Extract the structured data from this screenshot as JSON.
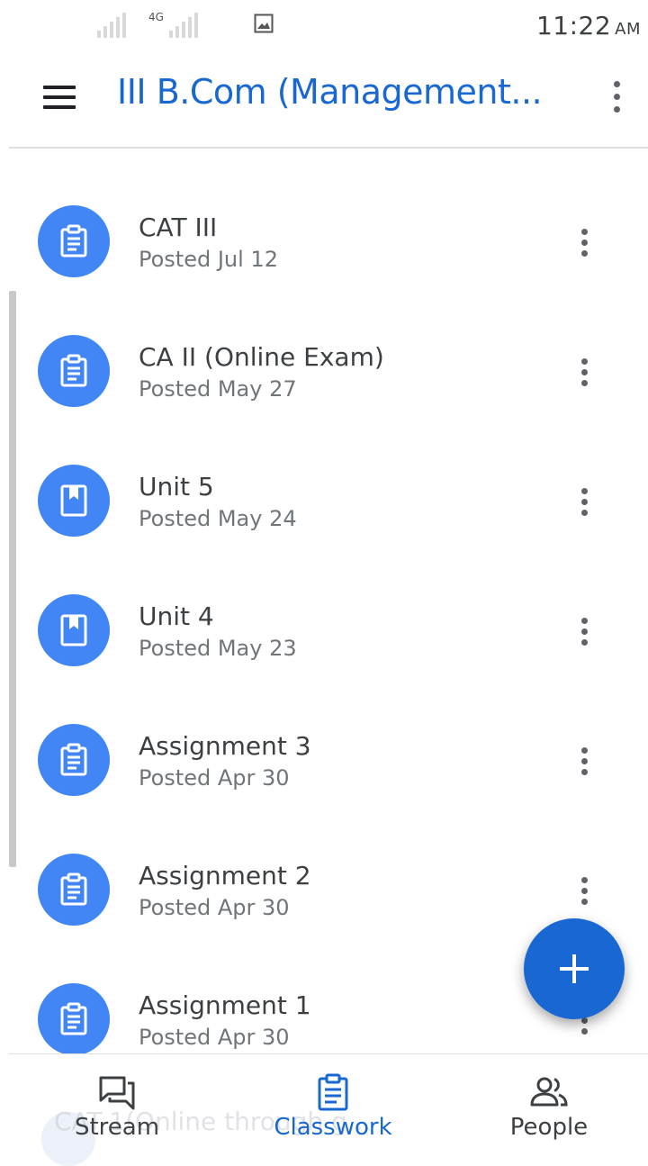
{
  "status_bar": {
    "network": "4G",
    "time": "11:22",
    "ampm": "AM"
  },
  "app_bar": {
    "title": "III B.Com (Management..."
  },
  "items": [
    {
      "title": "CAT III",
      "posted": "Posted Jul 12",
      "icon": "assignment-icon"
    },
    {
      "title": "CA II (Online Exam)",
      "posted": "Posted May 27",
      "icon": "assignment-icon"
    },
    {
      "title": "Unit 5",
      "posted": "Posted May 24",
      "icon": "material-icon"
    },
    {
      "title": "Unit 4",
      "posted": "Posted May 23",
      "icon": "material-icon"
    },
    {
      "title": "Assignment 3",
      "posted": "Posted Apr 30",
      "icon": "assignment-icon"
    },
    {
      "title": "Assignment 2",
      "posted": "Posted Apr 30",
      "icon": "assignment-icon"
    },
    {
      "title": "Assignment 1",
      "posted": "Posted Apr 30",
      "icon": "assignment-icon"
    }
  ],
  "ghost_item": {
    "title": "CAT-1(Online through g..."
  },
  "bottom_nav": [
    {
      "label": "Stream",
      "icon": "stream-icon",
      "active": false
    },
    {
      "label": "Classwork",
      "icon": "classwork-icon",
      "active": true
    },
    {
      "label": "People",
      "icon": "people-icon",
      "active": false
    }
  ],
  "colors": {
    "accent": "#1967d2",
    "avatar": "#4285f4",
    "text": "#3c4043",
    "subtext": "#70757a"
  }
}
